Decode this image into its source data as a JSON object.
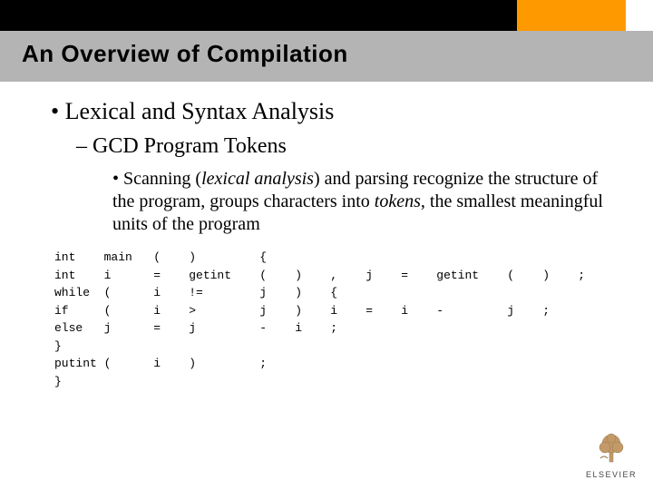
{
  "header": {
    "title": "An Overview of Compilation"
  },
  "bullets": {
    "level1": "Lexical and Syntax Analysis",
    "level2": "GCD Program Tokens",
    "level3_prefix": "• Scanning (",
    "level3_italic1": "lexical analysis",
    "level3_mid1": ") and parsing recognize the structure of the program, groups characters into ",
    "level3_italic2": "tokens",
    "level3_mid2": ", the smallest meaningful units of the program"
  },
  "tokens_text": "int    main   (    )         {\nint    i      =    getint    (    )    ,    j    =    getint    (    )    ;\nwhile  (      i    !=        j    )    {\nif     (      i    >         j    )    i    =    i    -         j    ;\nelse   j      =    j         -    i    ;\n}\nputint (      i    )         ;\n}",
  "logo": {
    "label": "ELSEVIER"
  }
}
